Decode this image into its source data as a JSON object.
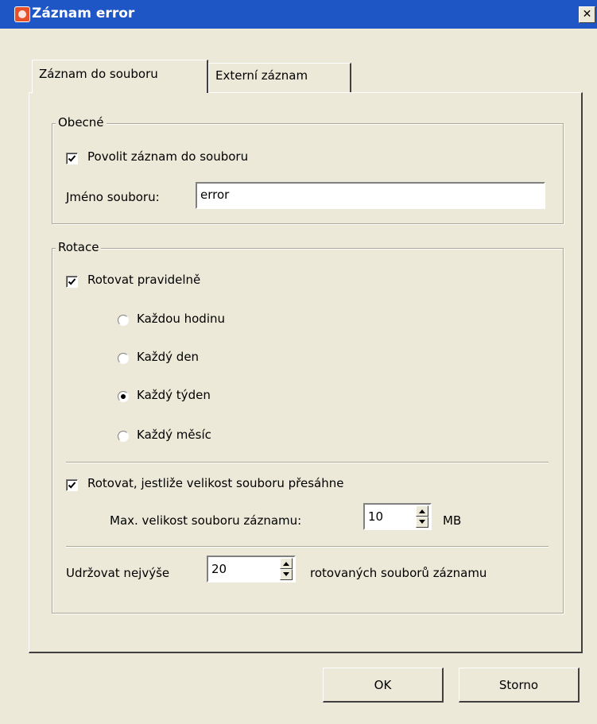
{
  "window": {
    "title": "Záznam error",
    "close_glyph": "✕"
  },
  "tabs": [
    {
      "label": "Záznam do souboru",
      "active": true
    },
    {
      "label": "Externí záznam",
      "active": false
    }
  ],
  "general": {
    "legend": "Obecné",
    "enable_label": "Povolit záznam do souboru",
    "enable_checked": true,
    "filename_label": "Jméno souboru:",
    "filename_value": "error"
  },
  "rotation": {
    "legend": "Rotace",
    "periodic_label": "Rotovat pravidelně",
    "periodic_checked": true,
    "options": [
      {
        "label": "Každou hodinu",
        "selected": false
      },
      {
        "label": "Každý den",
        "selected": false
      },
      {
        "label": "Každý týden",
        "selected": true
      },
      {
        "label": "Každý měsíc",
        "selected": false
      }
    ],
    "size_label": "Rotovat, jestliže velikost souboru přesáhne",
    "size_checked": true,
    "max_size_label": "Max. velikost souboru záznamu:",
    "max_size_value": "10",
    "max_size_unit": "MB",
    "keep_label_before": "Udržovat nejvýše",
    "keep_value": "20",
    "keep_label_after": "rotovaných souborů záznamu"
  },
  "buttons": {
    "ok": "OK",
    "cancel": "Storno"
  },
  "icons": {
    "app": "log-app-icon",
    "close": "close-icon",
    "check": "checkmark-icon",
    "spin_up": "spin-up-arrow-icon",
    "spin_down": "spin-down-arrow-icon"
  },
  "colors": {
    "titlebar": "#1f56c6",
    "dialog_bg": "#ece9d8"
  }
}
